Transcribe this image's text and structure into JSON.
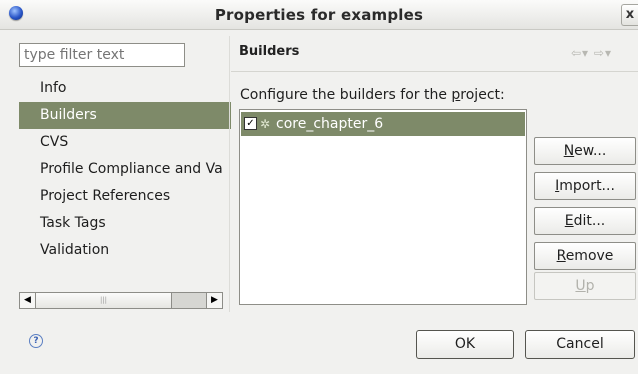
{
  "window": {
    "title": "Properties for examples",
    "close_glyph": "x"
  },
  "filter": {
    "placeholder": "type filter text"
  },
  "nav": {
    "items": [
      {
        "label": "Info"
      },
      {
        "label": "Builders",
        "selected": true
      },
      {
        "label": "CVS"
      },
      {
        "label": "Profile Compliance and Va"
      },
      {
        "label": "Project References"
      },
      {
        "label": "Task Tags"
      },
      {
        "label": "Validation"
      }
    ]
  },
  "page": {
    "title": "Builders",
    "description_prefix": "Configure the builders for the ",
    "description_mnemonic": "p",
    "description_suffix": "roject:"
  },
  "builders": [
    {
      "name": "core_chapter_6",
      "checked": true,
      "selected": true
    }
  ],
  "buttons": {
    "new": {
      "mnemonic": "N",
      "rest": "ew..."
    },
    "import": {
      "mnemonic": "I",
      "rest": "mport..."
    },
    "edit": {
      "mnemonic": "E",
      "rest": "dit..."
    },
    "remove": {
      "mnemonic": "R",
      "rest": "emove"
    },
    "up": {
      "mnemonic": "U",
      "rest": "p",
      "disabled": true
    }
  },
  "footer": {
    "help_glyph": "?",
    "ok": "OK",
    "cancel": "Cancel"
  },
  "colors": {
    "selection": "#7e8a69",
    "window_bg": "#f1f1ef"
  }
}
